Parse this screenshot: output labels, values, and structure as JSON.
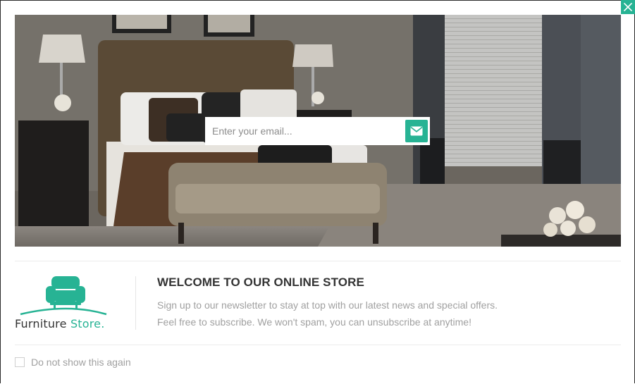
{
  "popup": {
    "close_icon": "close-icon",
    "accent_color": "#27b394"
  },
  "hero": {
    "image": "bedroom-photo",
    "email_placeholder": "Enter your email...",
    "submit_icon": "envelope-icon"
  },
  "brand": {
    "logo_icon": "armchair-icon",
    "name_main": "Furniture",
    "name_accent": "Store."
  },
  "content": {
    "heading": "WELCOME TO OUR ONLINE STORE",
    "line1": "Sign up to our newsletter to stay at top with our latest news and special offers.",
    "line2": "Feel free to subscribe. We won't spam, you can unsubscribe at anytime!"
  },
  "footer": {
    "dont_show_label": "Do not show this again"
  }
}
